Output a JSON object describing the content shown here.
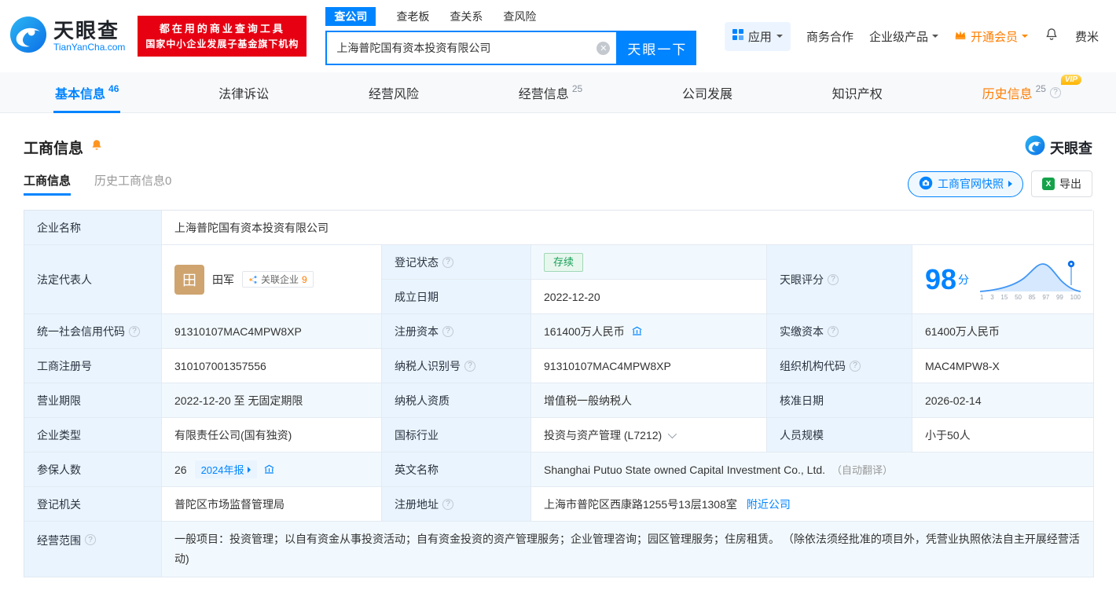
{
  "brand": {
    "name": "天眼查",
    "domain": "TianYanCha.com"
  },
  "slogan": {
    "line1": "都在用的商业查询工具",
    "line2": "国家中小企业发展子基金旗下机构"
  },
  "search": {
    "tabs": [
      "查公司",
      "查老板",
      "查关系",
      "查风险"
    ],
    "value": "上海普陀国有资本投资有限公司",
    "button": "天眼一下"
  },
  "header_right": {
    "apps": "应用",
    "cooperation": "商务合作",
    "enterprise": "企业级产品",
    "vip": "开通会员",
    "user": "费米"
  },
  "nav": {
    "vip_badge": "VIP",
    "items": [
      {
        "label": "基本信息",
        "count": "46"
      },
      {
        "label": "法律诉讼",
        "count": ""
      },
      {
        "label": "经营风险",
        "count": ""
      },
      {
        "label": "经营信息",
        "count": "25"
      },
      {
        "label": "公司发展",
        "count": ""
      },
      {
        "label": "知识产权",
        "count": ""
      },
      {
        "label": "历史信息",
        "count": "25"
      }
    ]
  },
  "section": {
    "title": "工商信息",
    "watermark": "天眼查",
    "subtabs": [
      "工商信息",
      "历史工商信息0"
    ],
    "snapshot_button": "工商官网快照",
    "export_button": "导出"
  },
  "table": {
    "company_name": {
      "label": "企业名称",
      "value": "上海普陀国有资本投资有限公司"
    },
    "legal_rep": {
      "label": "法定代表人",
      "avatar": "田",
      "name": "田军",
      "related": "关联企业",
      "related_count": "9"
    },
    "reg_status": {
      "label": "登记状态",
      "value": "存续"
    },
    "establish_date": {
      "label": "成立日期",
      "value": "2022-12-20"
    },
    "score": {
      "label": "天眼评分",
      "value": "98",
      "unit": "分",
      "axis": [
        "1",
        "3",
        "15",
        "50",
        "85",
        "97",
        "99",
        "100"
      ]
    },
    "credit_code": {
      "label": "统一社会信用代码",
      "value": "91310107MAC4MPW8XP"
    },
    "reg_capital": {
      "label": "注册资本",
      "value": "161400万人民币"
    },
    "paid_capital": {
      "label": "实缴资本",
      "value": "61400万人民币"
    },
    "reg_number": {
      "label": "工商注册号",
      "value": "310107001357556"
    },
    "taxpayer_id": {
      "label": "纳税人识别号",
      "value": "91310107MAC4MPW8XP"
    },
    "org_code": {
      "label": "组织机构代码",
      "value": "MAC4MPW8-X"
    },
    "term": {
      "label": "营业期限",
      "value": "2022-12-20 至 无固定期限"
    },
    "taxpayer_quality": {
      "label": "纳税人资质",
      "value": "增值税一般纳税人"
    },
    "approval_date": {
      "label": "核准日期",
      "value": "2026-02-14"
    },
    "company_type": {
      "label": "企业类型",
      "value": "有限责任公司(国有独资)"
    },
    "industry": {
      "label": "国标行业",
      "value": "投资与资产管理 (L7212)"
    },
    "staff": {
      "label": "人员规模",
      "value": "小于50人"
    },
    "insured": {
      "label": "参保人数",
      "value": "26",
      "badge": "2024年报"
    },
    "english_name": {
      "label": "英文名称",
      "value": "Shanghai Putuo State owned Capital Investment Co., Ltd.",
      "note": "（自动翻译）"
    },
    "authority": {
      "label": "登记机关",
      "value": "普陀区市场监督管理局"
    },
    "address": {
      "label": "注册地址",
      "value": "上海市普陀区西康路1255号13层1308室",
      "link": "附近公司"
    },
    "scope": {
      "label": "经营范围",
      "value": "一般项目：投资管理；以自有资金从事投资活动；自有资金投资的资产管理服务；企业管理咨询；园区管理服务；住房租赁。 （除依法须经批准的项目外，凭营业执照依法自主开展经营活动)"
    }
  }
}
